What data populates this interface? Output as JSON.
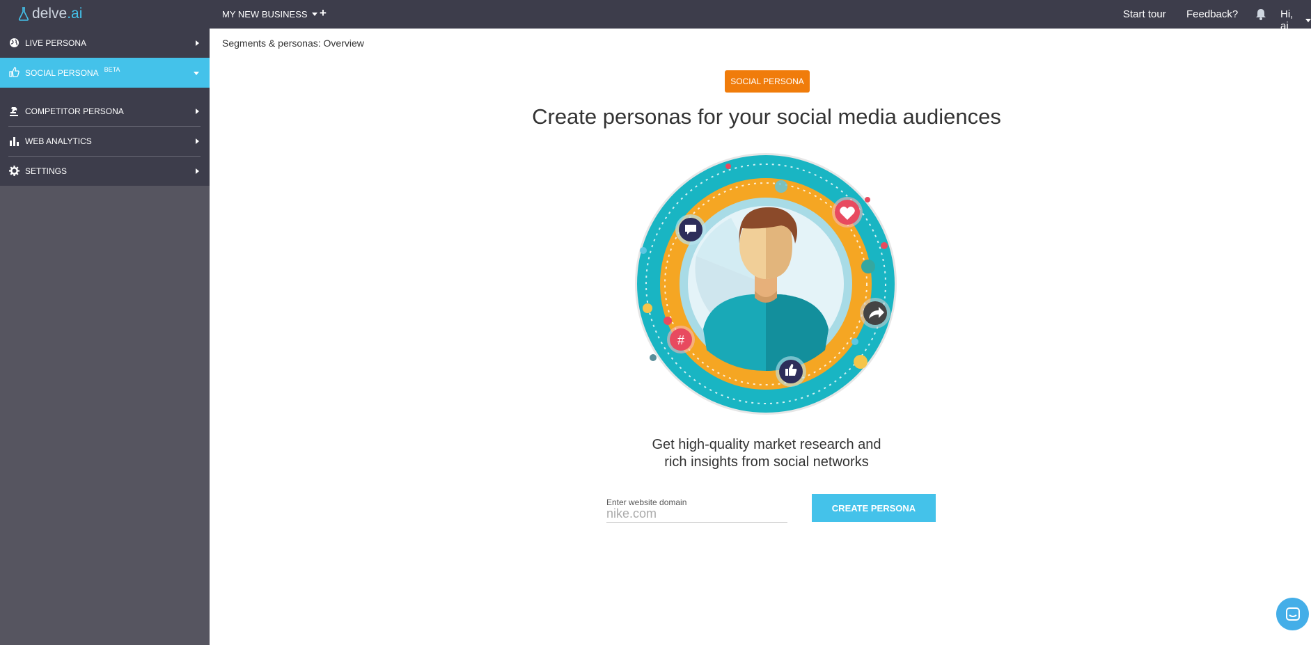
{
  "app": {
    "logo_text": "delve",
    "logo_suffix": ".ai"
  },
  "header": {
    "business": "MY NEW BUSINESS",
    "add": "+",
    "start_tour": "Start tour",
    "feedback": "Feedback?",
    "user": "Hi, ai"
  },
  "sidebar": {
    "items": [
      {
        "label": "LIVE PERSONA",
        "icon": "globe-icon"
      },
      {
        "label": "SOCIAL PERSONA",
        "badge": "BETA",
        "icon": "thumbs-up-icon",
        "active": true
      },
      {
        "label": "COMPETITOR PERSONA",
        "icon": "chess-icon"
      },
      {
        "label": "WEB ANALYTICS",
        "icon": "bar-chart-icon"
      },
      {
        "label": "SETTINGS",
        "icon": "gear-icon"
      }
    ]
  },
  "main": {
    "breadcrumb": "Segments & personas: Overview",
    "badge": "SOCIAL PERSONA",
    "headline": "Create personas for your social media audiences",
    "tagline_line1": "Get high-quality market research and",
    "tagline_line2": "rich insights from social networks",
    "domain_label": "Enter website domain",
    "domain_placeholder": "nike.com",
    "domain_value": "",
    "cta": "CREATE PERSONA"
  },
  "colors": {
    "topbar": "#3d3d4b",
    "sidebar": "#565560",
    "accent": "#44c2ea",
    "badge": "#f07c0b"
  }
}
